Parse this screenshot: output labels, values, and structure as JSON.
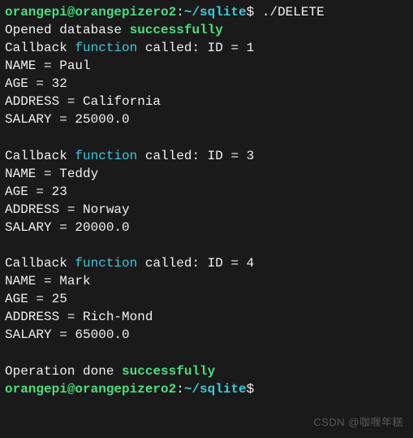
{
  "prompt1": {
    "user": "orangepi@orangepizero2",
    "sep": ":",
    "path": "~/sqlite",
    "dollar": "$ ",
    "command": "./DELETE"
  },
  "opened": {
    "prefix": "Opened database ",
    "status": "successfully"
  },
  "records": [
    {
      "callback_prefix": "Callback ",
      "callback_word": "function",
      "callback_suffix": " called: ID = 1",
      "name": "NAME = Paul",
      "age": "AGE = 32",
      "address": "ADDRESS = California",
      "salary": "SALARY = 25000.0"
    },
    {
      "callback_prefix": "Callback ",
      "callback_word": "function",
      "callback_suffix": " called: ID = 3",
      "name": "NAME = Teddy",
      "age": "AGE = 23",
      "address": "ADDRESS = Norway",
      "salary": "SALARY = 20000.0"
    },
    {
      "callback_prefix": "Callback ",
      "callback_word": "function",
      "callback_suffix": " called: ID = 4",
      "name": "NAME = Mark",
      "age": "AGE = 25",
      "address": "ADDRESS = Rich-Mond",
      "salary": "SALARY = 65000.0"
    }
  ],
  "done": {
    "prefix": "Operation done ",
    "status": "successfully"
  },
  "prompt2": {
    "user": "orangepi@orangepizero2",
    "sep": ":",
    "path": "~/sqlite",
    "dollar": "$"
  },
  "watermark": "CSDN @咖喱年糕"
}
